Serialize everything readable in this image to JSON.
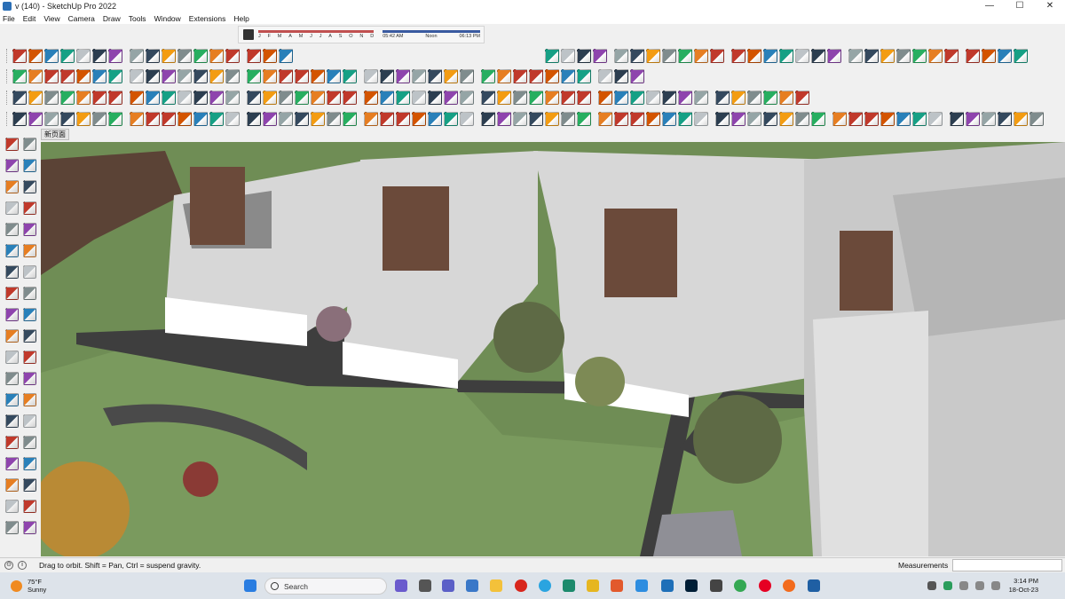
{
  "window": {
    "title": "v (140) - SketchUp Pro 2022",
    "controls": {
      "minimize": "—",
      "maximize": "☐",
      "close": "✕"
    }
  },
  "menu": [
    "File",
    "Edit",
    "View",
    "Camera",
    "Draw",
    "Tools",
    "Window",
    "Extensions",
    "Help"
  ],
  "shadow_settings": {
    "months": [
      "J",
      "F",
      "M",
      "A",
      "M",
      "J",
      "J",
      "A",
      "S",
      "O",
      "N",
      "D"
    ],
    "time_start": "05:42 AM",
    "time_mid": "Noon",
    "time_end": "06:13 PM"
  },
  "scene_tabs": [
    "新页面"
  ],
  "toolbar_rows": [
    {
      "name": "row1",
      "icon_count": 46
    },
    {
      "name": "row2",
      "icon_count": 38
    },
    {
      "name": "row3",
      "icon_count": 48
    },
    {
      "name": "row4",
      "icon_count": 62
    }
  ],
  "left_tools": [
    "select",
    "orbit",
    "paint-bucket",
    "eraser",
    "move-tool",
    "pencil",
    "line",
    "freehand",
    "rectangle",
    "rotated-rect",
    "circle",
    "polygon",
    "arc",
    "pie",
    "offset",
    "follow-me",
    "push-pull",
    "scale",
    "rotate",
    "flip",
    "tape-measure",
    "text",
    "protractor",
    "axes",
    "dimension",
    "section",
    "orbit-camera",
    "pan",
    "zoom",
    "zoom-window",
    "zoom-extents",
    "previous",
    "walk",
    "look-around",
    "position-camera",
    "advanced-camera",
    "sandbox",
    "smoove"
  ],
  "status": {
    "hint": "Drag to orbit. Shift = Pan, Ctrl = suspend gravity.",
    "measurements_label": "Measurements",
    "measurements_value": ""
  },
  "taskbar": {
    "weather_temp": "75°F",
    "weather_desc": "Sunny",
    "search_label": "Search",
    "time": "3:14 PM",
    "date": "18-Oct-23"
  },
  "colors": {
    "grass": "#6f8d55",
    "path": "#3e3e3e",
    "building": "#d7d7d7",
    "louver": "#6b4a3a",
    "tree": "#5e6a45"
  }
}
